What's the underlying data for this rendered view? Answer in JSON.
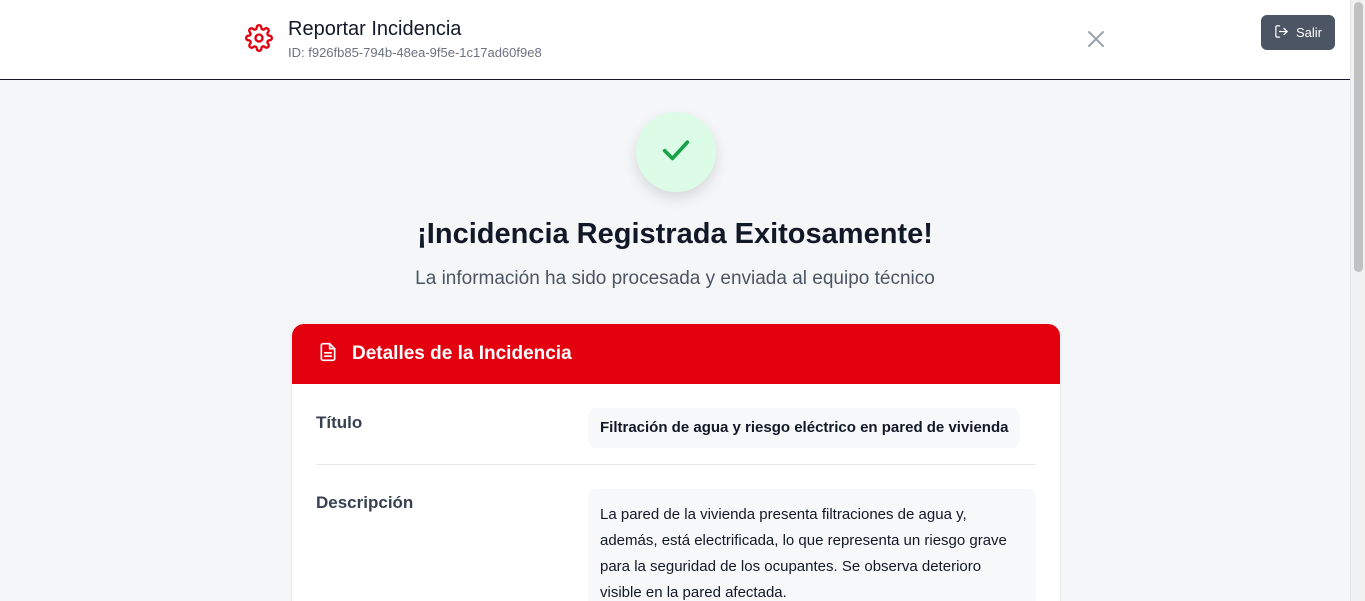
{
  "header": {
    "icon": "gear-icon",
    "title": "Reportar Incidencia",
    "id_text": "ID: f926fb85-794b-48ea-9f5e-1c17ad60f9e8",
    "close_icon": "close-icon",
    "exit_label": "Salir",
    "exit_icon": "logout-icon",
    "accent_color": "#e3000f"
  },
  "success": {
    "icon": "check-icon",
    "title": "¡Incidencia Registrada Exitosamente!",
    "subtitle": "La información ha sido procesada y enviada al equipo técnico"
  },
  "details": {
    "icon": "document-icon",
    "title": "Detalles de la Incidencia",
    "rows": [
      {
        "label": "Título",
        "value": "Filtración de agua y riesgo eléctrico en pared de vivienda"
      },
      {
        "label": "Descripción",
        "value": "La pared de la vivienda presenta filtraciones de agua y, además, está electrificada, lo que representa un riesgo grave para la seguridad de los ocupantes. Se observa deterioro visible en la pared afectada."
      }
    ]
  }
}
